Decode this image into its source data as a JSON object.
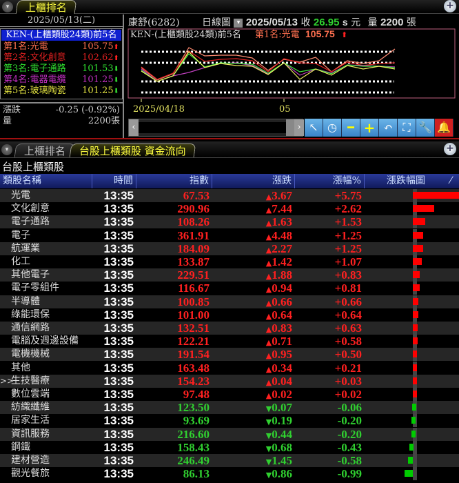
{
  "top_tab": {
    "label": "上櫃排名"
  },
  "left": {
    "date": "2025/05/13(二)",
    "header": "KEN-(上櫃類股24類)前5名",
    "ranks": [
      {
        "label": "第1名:光電",
        "value": "105.75",
        "dir": "up",
        "color": "#ff7050"
      },
      {
        "label": "第2名:文化創意",
        "value": "102.62",
        "dir": "up",
        "color": "#e02020"
      },
      {
        "label": "第3名:電子通路",
        "value": "101.53",
        "dir": "down",
        "color": "#30e030"
      },
      {
        "label": "第4名:電器電纜",
        "value": "101.25",
        "dir": "down",
        "color": "#c030c0"
      },
      {
        "label": "第5名:玻璃陶瓷",
        "value": "101.25",
        "dir": "down",
        "color": "#e0e040"
      }
    ],
    "change_label": "漲跌",
    "change_value": "-0.25 (-0.92%)",
    "volume_label": "量",
    "volume_value": "2200張"
  },
  "header": {
    "stock": "康舒(6282)",
    "chart_type": "日線圖",
    "date": "2025/05/13",
    "close_label": "收",
    "close": "26.95",
    "close_suffix": "s",
    "unit": "元",
    "vol_label": "量",
    "vol": "2200",
    "vol_unit": "張"
  },
  "chart_data": {
    "type": "line",
    "title": "KEN-(上櫃類股24類)前5名",
    "highlight": {
      "label": "第1名:光電",
      "value": "105.75"
    },
    "x_labels": [
      {
        "index": 0,
        "text": "2025/04/18"
      },
      {
        "index": 9,
        "text": "05"
      }
    ],
    "ylim": [
      97,
      107
    ],
    "gridlines": [
      103.7,
      102.1,
      99.4,
      97.8
    ],
    "series": [
      {
        "name": "光電",
        "color": "#ff8a70",
        "values": [
          101.4,
          99.6,
          100.5,
          104.3,
          103.1,
          103.2,
          103.2,
          102.8,
          101.0,
          102.6,
          102.2,
          102.9,
          100.8,
          102.4,
          102.0,
          102.4,
          104.1
        ]
      },
      {
        "name": "文化創意",
        "color": "#e02020",
        "values": [
          101.5,
          99.7,
          100.6,
          103.8,
          102.3,
          102.6,
          102.7,
          102.4,
          100.8,
          102.7,
          102.1,
          102.0,
          100.8,
          102.2,
          101.7,
          102.0,
          102.1
        ]
      },
      {
        "name": "電器電纜",
        "color": "#c040c0",
        "values": [
          101.2,
          99.4,
          100.2,
          100.7,
          101.4,
          102.0,
          102.1,
          101.7,
          100.5,
          102.1,
          100.3,
          101.2,
          100.6,
          101.8,
          101.7,
          101.6,
          101.5
        ]
      },
      {
        "name": "電子通路",
        "color": "#40e040",
        "values": [
          101.0,
          99.4,
          100.2,
          103.4,
          101.5,
          102.1,
          102.0,
          101.9,
          100.6,
          102.1,
          100.8,
          101.2,
          100.5,
          101.8,
          101.6,
          101.6,
          101.4
        ]
      },
      {
        "name": "玻璃陶瓷",
        "color": "#f0f060",
        "values": [
          100.9,
          99.4,
          100.2,
          103.7,
          101.4,
          102.0,
          101.7,
          101.6,
          100.4,
          102.1,
          99.7,
          101.2,
          100.3,
          101.7,
          101.2,
          101.6,
          101.2
        ]
      }
    ]
  },
  "toolbar": [
    "arrow",
    "clock",
    "minus",
    "plus",
    "undo",
    "fit",
    "wrench",
    "bell"
  ],
  "bottom_tabs": [
    {
      "label": "上櫃排名",
      "active": false
    },
    {
      "label": "台股上櫃類股 資金流向",
      "active": true
    }
  ],
  "table": {
    "title": "台股上櫃類股",
    "columns": [
      "類股名稱",
      "時間",
      "指數",
      "漲跌",
      "漲幅%",
      "漲跌幅圖"
    ],
    "rows": [
      {
        "name": "光電",
        "time": "13:35",
        "index": "67.53",
        "change": "3.67",
        "pct": "+5.75",
        "p": 5.75
      },
      {
        "name": "文化創意",
        "time": "13:35",
        "index": "290.96",
        "change": "7.44",
        "pct": "+2.62",
        "p": 2.62
      },
      {
        "name": "電子通路",
        "time": "13:35",
        "index": "108.26",
        "change": "1.63",
        "pct": "+1.53",
        "p": 1.53
      },
      {
        "name": "電子",
        "time": "13:35",
        "index": "361.91",
        "change": "4.48",
        "pct": "+1.25",
        "p": 1.25
      },
      {
        "name": "航運業",
        "time": "13:35",
        "index": "184.09",
        "change": "2.27",
        "pct": "+1.25",
        "p": 1.25
      },
      {
        "name": "化工",
        "time": "13:35",
        "index": "133.87",
        "change": "1.42",
        "pct": "+1.07",
        "p": 1.07
      },
      {
        "name": "其他電子",
        "time": "13:35",
        "index": "229.51",
        "change": "1.88",
        "pct": "+0.83",
        "p": 0.83
      },
      {
        "name": "電子零組件",
        "time": "13:35",
        "index": "116.67",
        "change": "0.94",
        "pct": "+0.81",
        "p": 0.81
      },
      {
        "name": "半導體",
        "time": "13:35",
        "index": "100.85",
        "change": "0.66",
        "pct": "+0.66",
        "p": 0.66
      },
      {
        "name": "綠能環保",
        "time": "13:35",
        "index": "101.00",
        "change": "0.64",
        "pct": "+0.64",
        "p": 0.64
      },
      {
        "name": "通信網路",
        "time": "13:35",
        "index": "132.51",
        "change": "0.83",
        "pct": "+0.63",
        "p": 0.63
      },
      {
        "name": "電腦及週邊設備",
        "time": "13:35",
        "index": "122.21",
        "change": "0.71",
        "pct": "+0.58",
        "p": 0.58
      },
      {
        "name": "電機機械",
        "time": "13:35",
        "index": "191.54",
        "change": "0.95",
        "pct": "+0.50",
        "p": 0.5
      },
      {
        "name": "其他",
        "time": "13:35",
        "index": "163.48",
        "change": "0.34",
        "pct": "+0.21",
        "p": 0.21
      },
      {
        "name": "生技醫療",
        "time": "13:35",
        "index": "154.23",
        "change": "0.04",
        "pct": "+0.03",
        "p": 0.03,
        "selected": true,
        "marker": ">>"
      },
      {
        "name": "數位雲端",
        "time": "13:35",
        "index": "97.48",
        "change": "0.02",
        "pct": "+0.02",
        "p": 0.02
      },
      {
        "name": "紡織纖維",
        "time": "13:35",
        "index": "123.50",
        "change": "0.07",
        "pct": "-0.06",
        "p": -0.06
      },
      {
        "name": "居家生活",
        "time": "13:35",
        "index": "93.69",
        "change": "0.19",
        "pct": "-0.20",
        "p": -0.2
      },
      {
        "name": "資訊服務",
        "time": "13:35",
        "index": "216.60",
        "change": "0.44",
        "pct": "-0.20",
        "p": -0.2
      },
      {
        "name": "鋼鐵",
        "time": "13:35",
        "index": "158.43",
        "change": "0.68",
        "pct": "-0.43",
        "p": -0.43
      },
      {
        "name": "建材營造",
        "time": "13:35",
        "index": "246.49",
        "change": "1.45",
        "pct": "-0.58",
        "p": -0.58
      },
      {
        "name": "觀光餐旅",
        "time": "13:35",
        "index": "86.13",
        "change": "0.86",
        "pct": "-0.99",
        "p": -0.99
      }
    ]
  },
  "colors": {
    "up": "#ff2020",
    "down": "#30d030",
    "header_bg": "#1a2a8a"
  }
}
